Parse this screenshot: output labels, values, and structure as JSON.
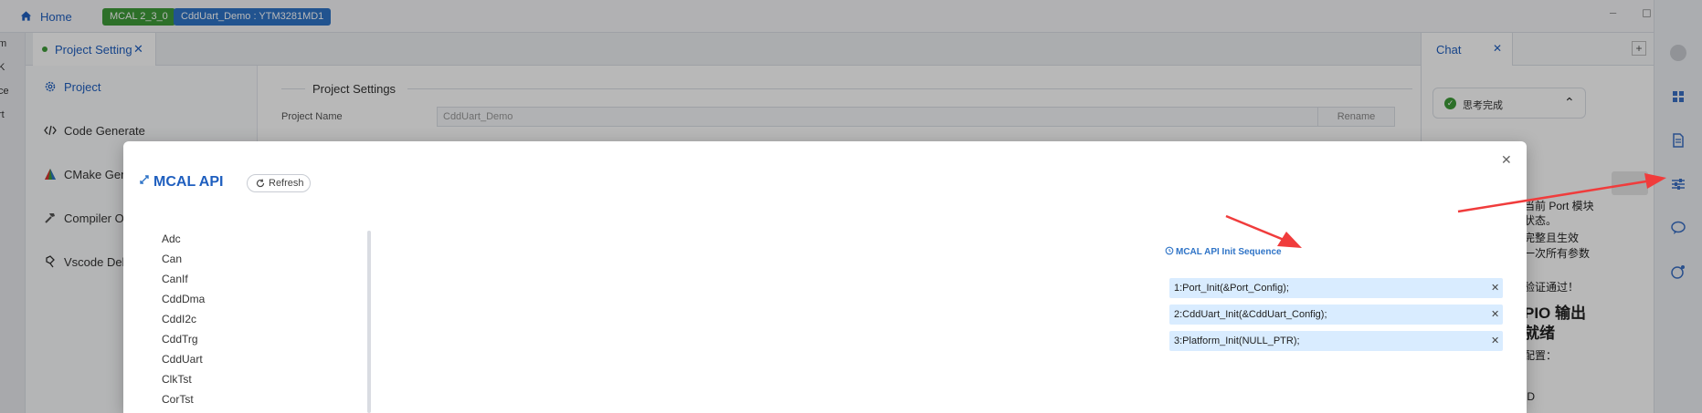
{
  "topbar": {
    "home_label": "Home",
    "badge_version": "MCAL 2_3_0",
    "badge_project": "CddUart_Demo : YTM3281MD1",
    "minimize": "–",
    "maximize": "◻",
    "close": "✕"
  },
  "leftstrip": [
    "m",
    "K",
    "ce",
    "rt"
  ],
  "tabs": {
    "project_setting": "Project Setting",
    "close": "✕"
  },
  "nav": {
    "items": [
      {
        "label": "Project",
        "icon": "gear-icon"
      },
      {
        "label": "Code Generate",
        "icon": "code-icon"
      },
      {
        "label": "CMake Gene",
        "icon": "cmake-icon"
      },
      {
        "label": "Compiler Op",
        "icon": "hammer-icon"
      },
      {
        "label": "Vscode Debu",
        "icon": "debug-icon"
      }
    ]
  },
  "settings": {
    "title": "Project Settings",
    "project_name_label": "Project Name",
    "project_name_value": "CddUart_Demo",
    "rename_label": "Rename"
  },
  "chat": {
    "tab_label": "Chat",
    "close": "✕",
    "plus": "+",
    "thinking_label": "思考完成",
    "lines": [
      "当前 Port 模块",
      "状态。",
      "完整且生效",
      "一次所有参数",
      "验证通过！",
      "PIO 输出",
      "就绪",
      "配置：",
      "",
      "ID"
    ]
  },
  "modal": {
    "title": "MCAL API",
    "refresh_label": "Refresh",
    "close": "✕",
    "modules": [
      "Adc",
      "Can",
      "CanIf",
      "CddDma",
      "CddI2c",
      "CddTrg",
      "CddUart",
      "ClkTst",
      "CorTst"
    ],
    "sequence_title": "MCAL API Init Sequence",
    "sequence": [
      "1:Port_Init(&Port_Config);",
      "2:CddUart_Init(&CddUart_Config);",
      "3:Platform_Init(NULL_PTR);"
    ],
    "remove_symbol": "✕"
  },
  "colors": {
    "accent": "#1f5fbf",
    "badge_green": "#3f9b3a",
    "badge_blue": "#2f74c7",
    "sequence_bg": "#d9ecff",
    "annotation_red": "#f03c3c"
  }
}
